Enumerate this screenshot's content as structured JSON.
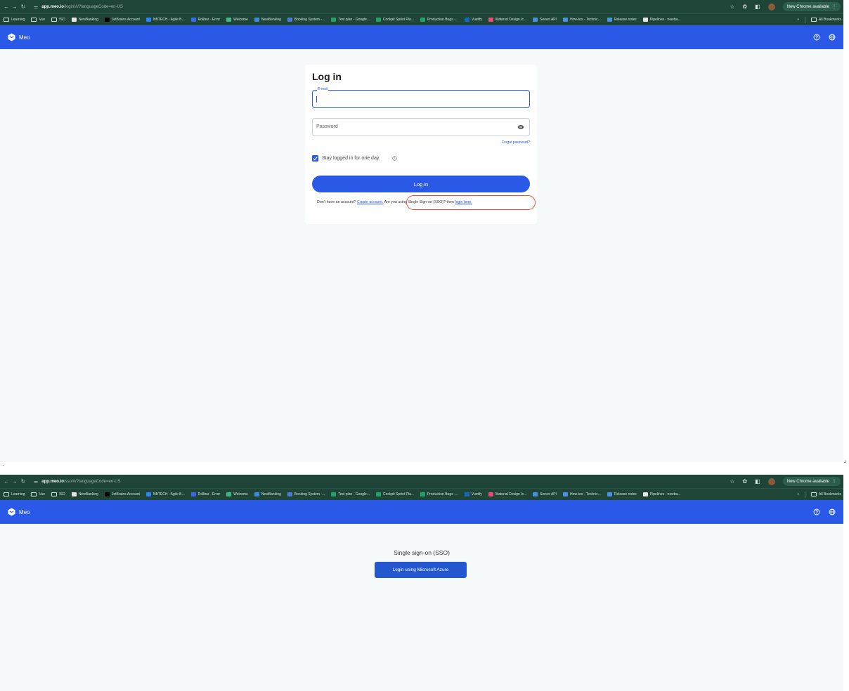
{
  "colors": {
    "chrome": "#1e4538",
    "appbar": "#2a59e8",
    "page": "#f6f9fa",
    "highlight": "#e0533c"
  },
  "screens": [
    {
      "url": {
        "domain": "app.meo.io",
        "path": "/login/#/?languageCode=en-US"
      },
      "update_label": "New Chrome available",
      "brand": "Meo",
      "login": {
        "title": "Log in",
        "email_label": "E-mail",
        "password_placeholder": "Password",
        "forgot_password": "Forgot password?",
        "stay_logged_in": "Stay logged in for one day.",
        "stay_logged_in_checked": true,
        "login_button": "Log in",
        "no_account_text": "Don't have an account?",
        "create_account_link": "Create account.",
        "sso_text": "Are you using Single Sign-on (SSO)? then",
        "sso_link": "login here."
      }
    },
    {
      "url": {
        "domain": "app.meo.io",
        "path": "/sso/#/?languageCode=en-US"
      },
      "update_label": "New Chrome available",
      "brand": "Meo",
      "sso": {
        "title": "Single sign-on (SSO)",
        "button": "Login using Microsoft Azure"
      }
    }
  ],
  "bookmarks": [
    {
      "label": "Learning",
      "icon": "folder-icon"
    },
    {
      "label": "Vue",
      "icon": "folder-icon"
    },
    {
      "label": "ISO",
      "icon": "folder-icon"
    },
    {
      "label": "NewBanking",
      "icon": "github-icon"
    },
    {
      "label": "JetBrains Account",
      "icon": "jetbrains-icon"
    },
    {
      "label": "NBTECH - Agile B...",
      "icon": "jira-icon"
    },
    {
      "label": "Rollbar - Error",
      "icon": "rollbar-icon"
    },
    {
      "label": "Welcome",
      "icon": "vue-icon"
    },
    {
      "label": "NewBanking",
      "icon": "sync-icon"
    },
    {
      "label": "Booking System -...",
      "icon": "booking-icon"
    },
    {
      "label": "Test plan - Google...",
      "icon": "sheets-icon"
    },
    {
      "label": "Cockpit Sprint Pla...",
      "icon": "sheets-icon"
    },
    {
      "label": "Production Bugs -...",
      "icon": "sheets-icon"
    },
    {
      "label": "Vuetify",
      "icon": "vuetify-icon"
    },
    {
      "label": "Material Design Ic...",
      "icon": "material-icon"
    },
    {
      "label": "Server API",
      "icon": "link-icon"
    },
    {
      "label": "How-tos - Technic...",
      "icon": "link-icon"
    },
    {
      "label": "Release notes",
      "icon": "link-icon"
    },
    {
      "label": "Pipelines - newba...",
      "icon": "github-icon"
    }
  ],
  "bookmarks_more": "»",
  "all_bookmarks": "All Bookmarks"
}
